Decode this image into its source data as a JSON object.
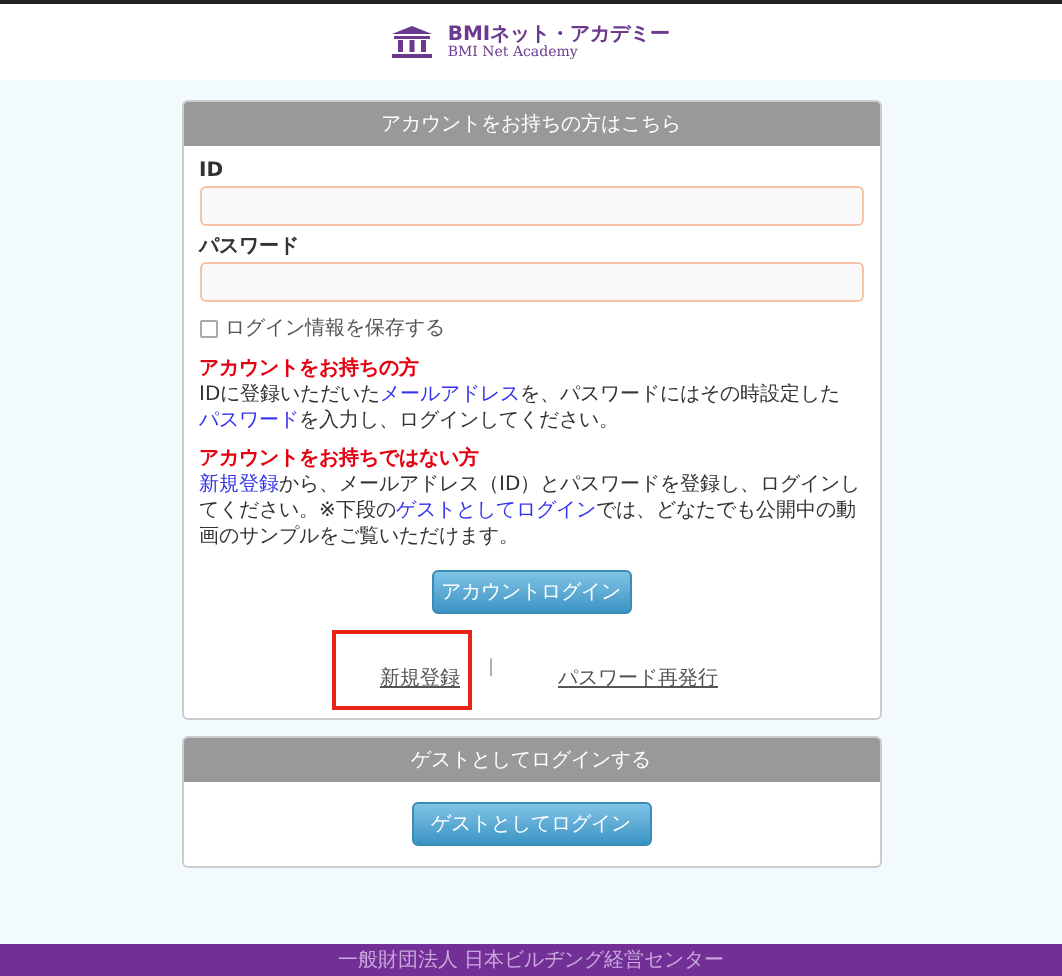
{
  "header": {
    "logo_title": "BMIネット・アカデミー",
    "logo_subtitle": "BMI Net Academy"
  },
  "account_panel": {
    "title": "アカウントをお持ちの方はこちら",
    "fields": [
      {
        "label": "ID"
      },
      {
        "label": "パスワード"
      }
    ],
    "remember": {
      "label": "ログイン情報を保存する",
      "checked": false
    },
    "notes": [
      {
        "heading": "アカウントをお持ちの方",
        "segments": [
          {
            "kind": "text",
            "text": "IDに登録いただいた"
          },
          {
            "kind": "link",
            "text": "メールアドレス"
          },
          {
            "kind": "text",
            "text": "を、パスワードにはその時設定した"
          },
          {
            "kind": "link",
            "text": "パスワード"
          },
          {
            "kind": "text",
            "text": "を入力し、ログインしてください。"
          }
        ]
      },
      {
        "heading": "アカウントをお持ちではない方",
        "segments": [
          {
            "kind": "link",
            "text": "新規登録"
          },
          {
            "kind": "text",
            "text": "から、メールアドレス（ID）とパスワードを登録し、ログインしてください。※下段の"
          },
          {
            "kind": "link",
            "text": "ゲストとしてログイン"
          },
          {
            "kind": "text",
            "text": "では、どなたでも公開中の動画のサンプルをご覧いただけます。"
          }
        ]
      }
    ],
    "button": "アカウントログイン",
    "links": [
      {
        "text": "新規登録",
        "highlighted": true
      },
      {
        "text": "パスワード再発行",
        "highlighted": false
      }
    ],
    "separator": "|"
  },
  "guest_panel": {
    "title": "ゲストとしてログインする",
    "button": "ゲストとしてログイン"
  },
  "footer": {
    "text": "一般財団法人 日本ビルヂング経営センター"
  }
}
